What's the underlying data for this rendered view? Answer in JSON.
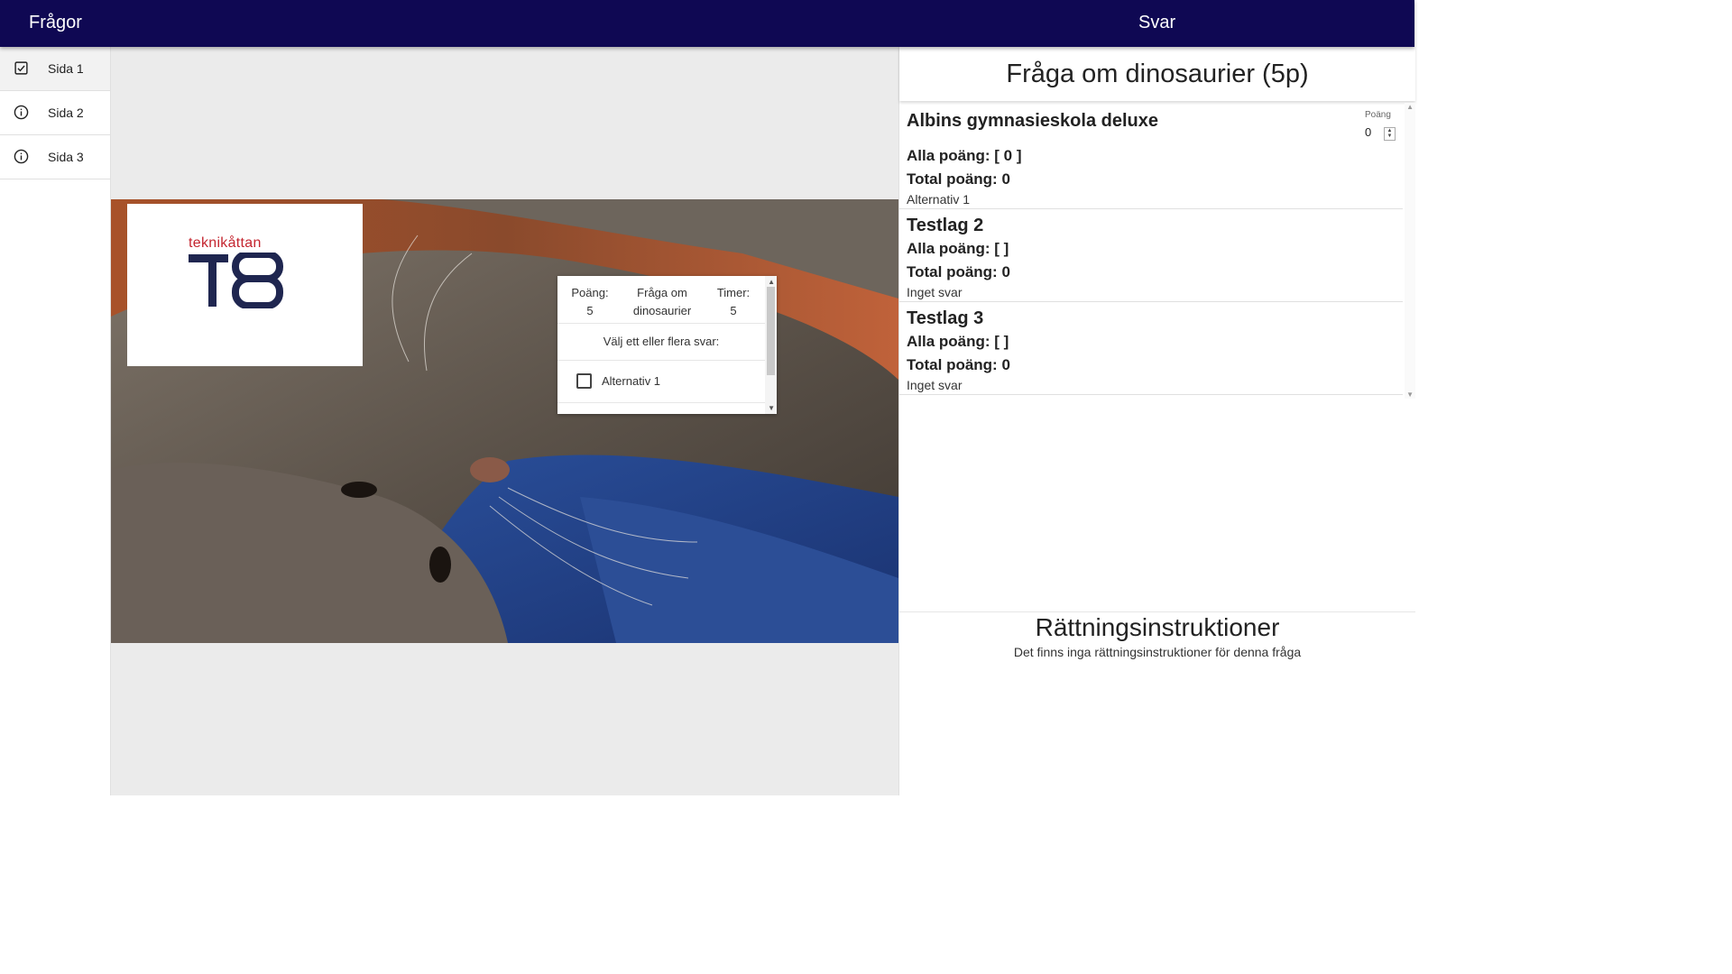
{
  "appbar": {
    "left_title": "Frågor",
    "right_title": "Svar"
  },
  "sidebar": {
    "items": [
      {
        "label": "Sida 1",
        "icon": "checkbox-checked-icon",
        "active": true
      },
      {
        "label": "Sida 2",
        "icon": "info-circle-icon",
        "active": false
      },
      {
        "label": "Sida 3",
        "icon": "info-circle-icon",
        "active": false
      }
    ]
  },
  "stage": {
    "logo": {
      "text": "teknikåttan",
      "mark": "T8"
    },
    "question_card": {
      "points_label": "Poäng:",
      "points_value": "5",
      "title_line1": "Fråga om",
      "title_line2": "dinosaurier",
      "timer_label": "Timer:",
      "timer_value": "5",
      "prompt": "Välj ett eller flera svar:",
      "options": [
        "Alternativ 1"
      ]
    }
  },
  "answers_panel": {
    "question_title": "Fråga om dinosaurier (5p)",
    "points_label": "Poäng",
    "points_value": "0",
    "teams": [
      {
        "name": "Albins gymnasieskola deluxe",
        "all_points": "Alla poäng: [ 0 ]",
        "total_points": "Total poäng: 0",
        "answer": "Alternativ 1"
      },
      {
        "name": "Testlag 2",
        "all_points": "Alla poäng: [ ]",
        "total_points": "Total poäng: 0",
        "answer": "Inget svar"
      },
      {
        "name": "Testlag 3",
        "all_points": "Alla poäng: [ ]",
        "total_points": "Total poäng: 0",
        "answer": "Inget svar"
      }
    ]
  },
  "correction": {
    "title": "Rättningsinstruktioner",
    "text": "Det finns inga rättningsinstruktioner för denna fråga"
  },
  "colors": {
    "appbar": "#0f0853",
    "logo_red": "#c4252f",
    "logo_navy": "#1f2650"
  }
}
